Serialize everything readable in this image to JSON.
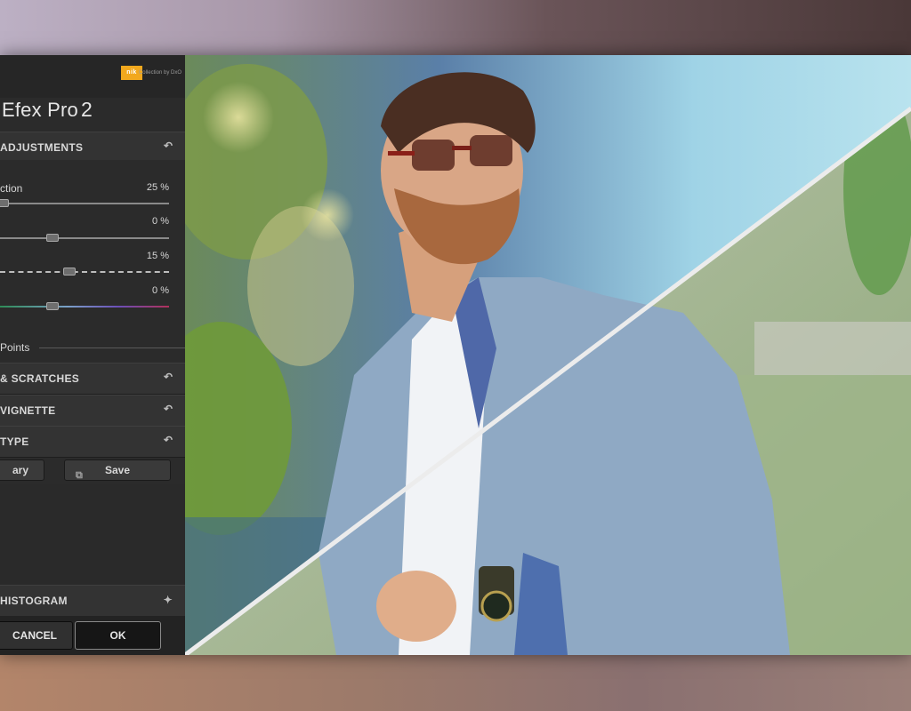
{
  "brand": {
    "logo_text": "nik",
    "collection_text": "Collection by DxO"
  },
  "app": {
    "title": "Efex Pro",
    "version": "2"
  },
  "sections": {
    "adjustments": {
      "label": "ADJUSTMENTS"
    },
    "scratches": {
      "label": "& SCRATCHES"
    },
    "vignette": {
      "label": "VIGNETTE"
    },
    "type": {
      "label": "TYPE"
    },
    "histogram": {
      "label": "HISTOGRAM"
    }
  },
  "sliders": [
    {
      "label": "ction",
      "value_text": "25 %",
      "value": 25
    },
    {
      "label": "",
      "value_text": "0 %",
      "value": 0
    },
    {
      "label": "",
      "value_text": "15 %",
      "value": 15
    },
    {
      "label": "",
      "value_text": "0 %",
      "value": 0
    }
  ],
  "control_points": {
    "label": "Points"
  },
  "buttons": {
    "library": "ary",
    "save": "Save",
    "cancel": "CANCEL",
    "ok": "OK"
  },
  "colors": {
    "nik_orange": "#f2a81d",
    "panel_bg": "#2b2b2b",
    "divider_line": "#e8e8e8"
  }
}
